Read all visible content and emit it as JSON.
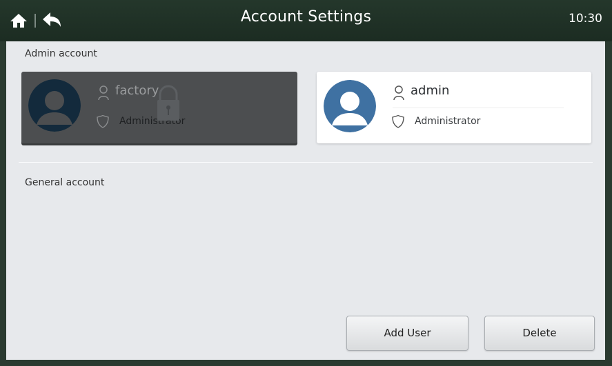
{
  "header": {
    "title": "Account Settings",
    "time": "10:30"
  },
  "sections": {
    "admin_label": "Admin account",
    "general_label": "General account"
  },
  "accounts": [
    {
      "name": "factory",
      "role": "Administrator",
      "locked": true
    },
    {
      "name": "admin",
      "role": "Administrator",
      "locked": false
    }
  ],
  "actions": {
    "add_user": "Add User",
    "delete": "Delete"
  },
  "colors": {
    "header_bg": "#1f3126",
    "panel_bg": "#e7e9ec",
    "avatar_blue": "#3f71a2",
    "avatar_dark": "#132a3c",
    "locked_card_bg": "#4c4e50"
  },
  "icons": [
    "home-icon",
    "back-icon",
    "user-icon",
    "shield-icon",
    "lock-icon"
  ]
}
